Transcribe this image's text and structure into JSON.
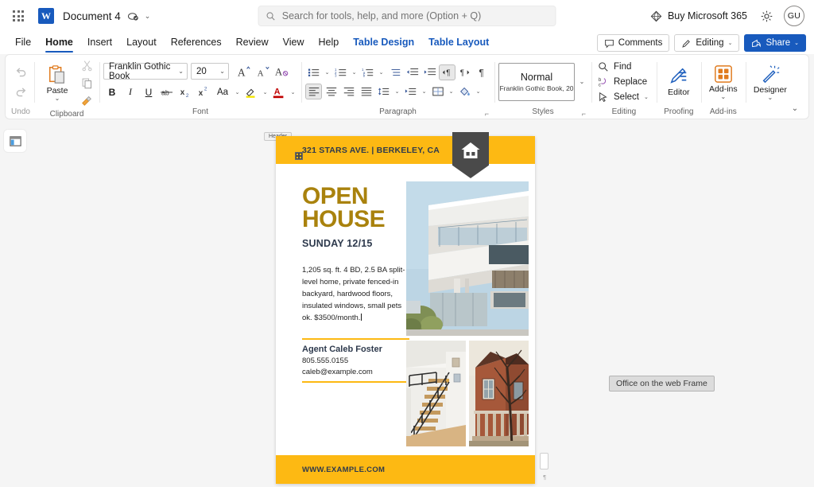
{
  "titlebar": {
    "app_launcher": "app-launcher",
    "document_title": "Document 4",
    "autosave": "autosave-icon",
    "title_chevron": "⌄",
    "buy_365": "Buy Microsoft 365",
    "avatar_initials": "GU"
  },
  "search": {
    "placeholder": "Search for tools, help, and more (Option + Q)",
    "value": ""
  },
  "tabs": [
    {
      "label": "File",
      "state": "normal"
    },
    {
      "label": "Home",
      "state": "active"
    },
    {
      "label": "Insert",
      "state": "normal"
    },
    {
      "label": "Layout",
      "state": "normal"
    },
    {
      "label": "References",
      "state": "normal"
    },
    {
      "label": "Review",
      "state": "normal"
    },
    {
      "label": "View",
      "state": "normal"
    },
    {
      "label": "Help",
      "state": "normal"
    },
    {
      "label": "Table Design",
      "state": "accent"
    },
    {
      "label": "Table Layout",
      "state": "accent"
    }
  ],
  "tabbar_actions": {
    "comments": "Comments",
    "editing": "Editing",
    "editing_chevron": "⌄",
    "share": "Share",
    "share_chevron": "⌄"
  },
  "ribbon": {
    "undo": {
      "label": "Undo"
    },
    "clipboard": {
      "paste_label": "Paste",
      "paste_chevron": "⌄",
      "label": "Clipboard"
    },
    "font": {
      "name": "Franklin Gothic Book",
      "size": "20",
      "label": "Font",
      "bold": "B",
      "italic": "I",
      "underline": "U",
      "strikethrough": "ab",
      "subscript": "x₂",
      "superscript": "x²",
      "change_case": "Aa"
    },
    "paragraph": {
      "label": "Paragraph"
    },
    "styles": {
      "style_name": "Normal",
      "style_detail": "Franklin Gothic Book, 20",
      "label": "Styles",
      "chevron": "⌄"
    },
    "editing": {
      "find": "Find",
      "replace": "Replace",
      "select": "Select",
      "select_chevron": "⌄",
      "label": "Editing"
    },
    "proofing": {
      "editor": "Editor",
      "label": "Proofing"
    },
    "addins": {
      "addins": "Add-ins",
      "chevron": "⌄",
      "label": "Add-ins"
    },
    "designer": {
      "designer": "Designer",
      "chevron": "⌄"
    },
    "collapse_chevron": "⌄"
  },
  "document": {
    "header_tag": "Header",
    "address": "321 STARS AVE. | BERKELEY, CA",
    "title_line1": "OPEN",
    "title_line2": "HOUSE",
    "subtitle": "SUNDAY 12/15",
    "description": "1,205 sq. ft. 4 BD, 2.5 BA split-level home, private fenced-in backyard, hardwood floors, insulated windows, small pets ok. $3500/month.",
    "agent_name": "Agent Caleb Foster",
    "agent_phone": "805.555.0155",
    "agent_email": "caleb@example.com",
    "footer_url": "WWW.EXAMPLE.COM",
    "pilcrow": "¶"
  },
  "overlay": {
    "frame_tooltip": "Office on the web Frame"
  },
  "colors": {
    "brand_blue": "#185abd",
    "flyer_yellow": "#fdb913",
    "flyer_gold": "#a9820d",
    "flyer_navy": "#2e3a4d",
    "badge_gray": "#4a4a4a"
  }
}
